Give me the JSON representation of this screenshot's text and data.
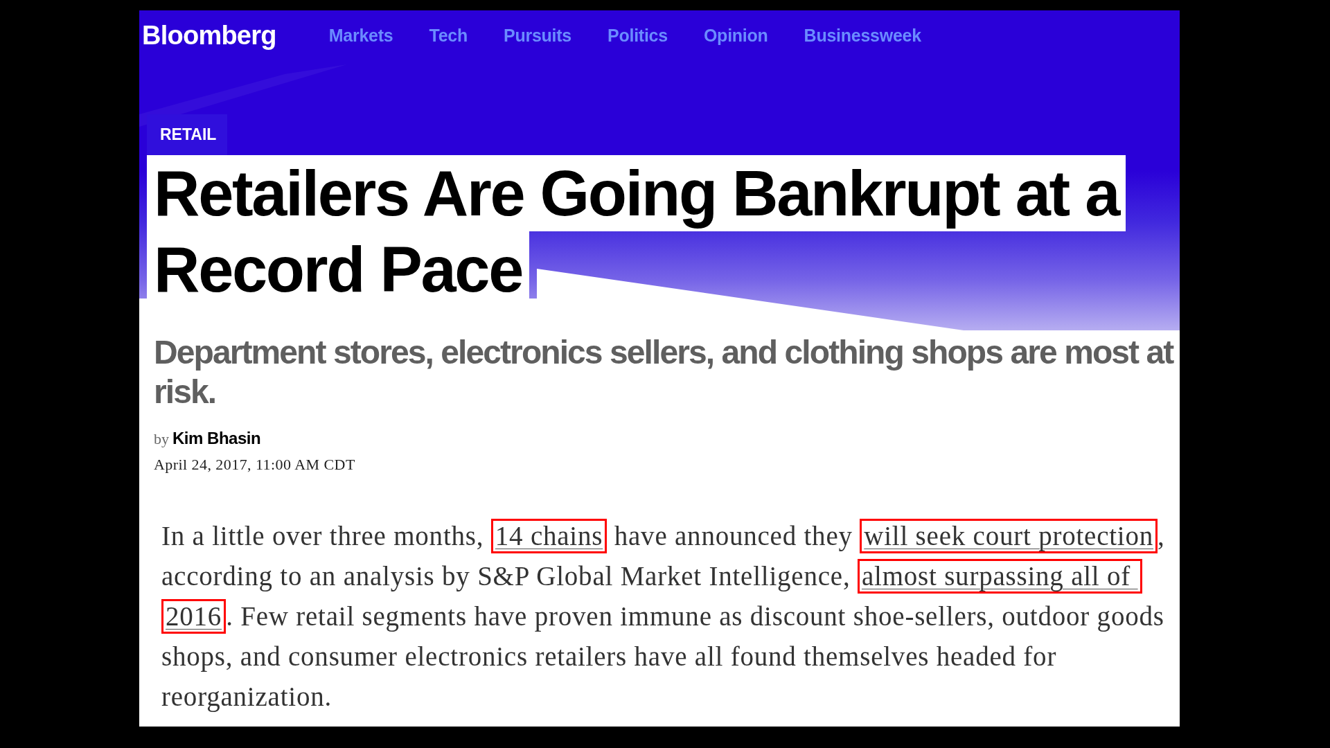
{
  "site": {
    "logo": "Bloomberg",
    "nav": [
      "Markets",
      "Tech",
      "Pursuits",
      "Politics",
      "Opinion",
      "Businessweek"
    ]
  },
  "article": {
    "section": "RETAIL",
    "headline": "Retailers Are Going Bankrupt at a Record Pace",
    "dek": "Department stores, electronics sellers, and clothing shops are most at risk.",
    "byline": {
      "prefix": "by",
      "author": "Kim Bhasin"
    },
    "timestamp": "April 24, 2017, 11:00 AM CDT",
    "paragraph": [
      {
        "kind": "text",
        "text": "In a little over three months, "
      },
      {
        "kind": "link",
        "text": "14 chains",
        "annotated": true
      },
      {
        "kind": "text",
        "text": " have announced they "
      },
      {
        "kind": "link",
        "text": "will seek court protection",
        "annotated": true
      },
      {
        "kind": "text",
        "text": ", according to an analysis by S&P Global Market Intelligence, "
      },
      {
        "kind": "link",
        "text": "almost surpassing all of ",
        "annotated": true
      },
      {
        "kind": "link",
        "text": "2016",
        "annotated": true
      },
      {
        "kind": "text",
        "text": ". Few retail segments have proven immune as discount shoe-sellers, outdoor goods shops, and consumer electronics retailers have all found themselves headed for reorganization."
      }
    ]
  }
}
